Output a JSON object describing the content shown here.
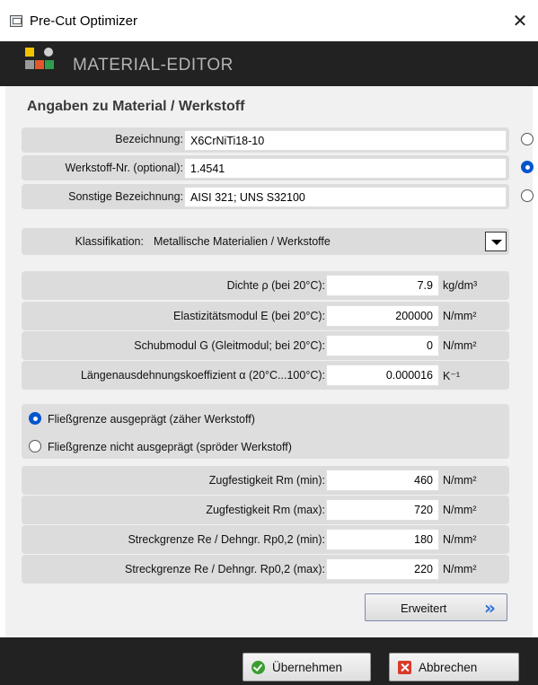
{
  "window": {
    "title": "Pre-Cut Optimizer",
    "close_glyph": "✕"
  },
  "header": {
    "title": "MATERIAL-EDITOR"
  },
  "section_title": "Angaben zu Material / Werkstoff",
  "names": [
    {
      "label": "Bezeichnung:",
      "value": "X6CrNiTi18-10",
      "selected": false
    },
    {
      "label": "Werkstoff-Nr. (optional):",
      "value": "1.4541",
      "selected": true
    },
    {
      "label": "Sonstige Bezeichnung:",
      "value": "AISI 321; UNS S32100",
      "selected": false
    }
  ],
  "classification": {
    "label": "Klassifikation:",
    "value": "Metallische Materialien / Werkstoffe"
  },
  "properties": [
    {
      "label": "Dichte ρ (bei 20°C):",
      "value": "7.9",
      "unit": "kg/dm³"
    },
    {
      "label": "Elastizitätsmodul E (bei 20°C):",
      "value": "200000",
      "unit": "N/mm²"
    },
    {
      "label": "Schubmodul G (Gleitmodul; bei 20°C):",
      "value": "0",
      "unit": "N/mm²"
    },
    {
      "label": "Längenausdehnungskoeffizient α (20°C...100°C):",
      "value": "0.000016",
      "unit": "K⁻¹"
    }
  ],
  "yield_options": [
    {
      "label": "Fließgrenze ausgeprägt (zäher Werkstoff)",
      "selected": true
    },
    {
      "label": "Fließgrenze nicht ausgeprägt (spröder Werkstoff)",
      "selected": false
    }
  ],
  "strength": [
    {
      "label": "Zugfestigkeit Rm (min):",
      "value": "460",
      "unit": "N/mm²"
    },
    {
      "label": "Zugfestigkeit Rm (max):",
      "value": "720",
      "unit": "N/mm²"
    },
    {
      "label": "Streckgrenze Re / Dehngr. Rp0,2 (min):",
      "value": "180",
      "unit": "N/mm²"
    },
    {
      "label": "Streckgrenze Re / Dehngr. Rp0,2 (max):",
      "value": "220",
      "unit": "N/mm²"
    }
  ],
  "buttons": {
    "extended": "Erweitert",
    "extended_icon": "»",
    "apply": "Übernehmen",
    "cancel": "Abbrechen"
  },
  "colors": {
    "header_bg": "#222222",
    "title_fg": "#b3b3b3",
    "accent": "#0055cc"
  }
}
